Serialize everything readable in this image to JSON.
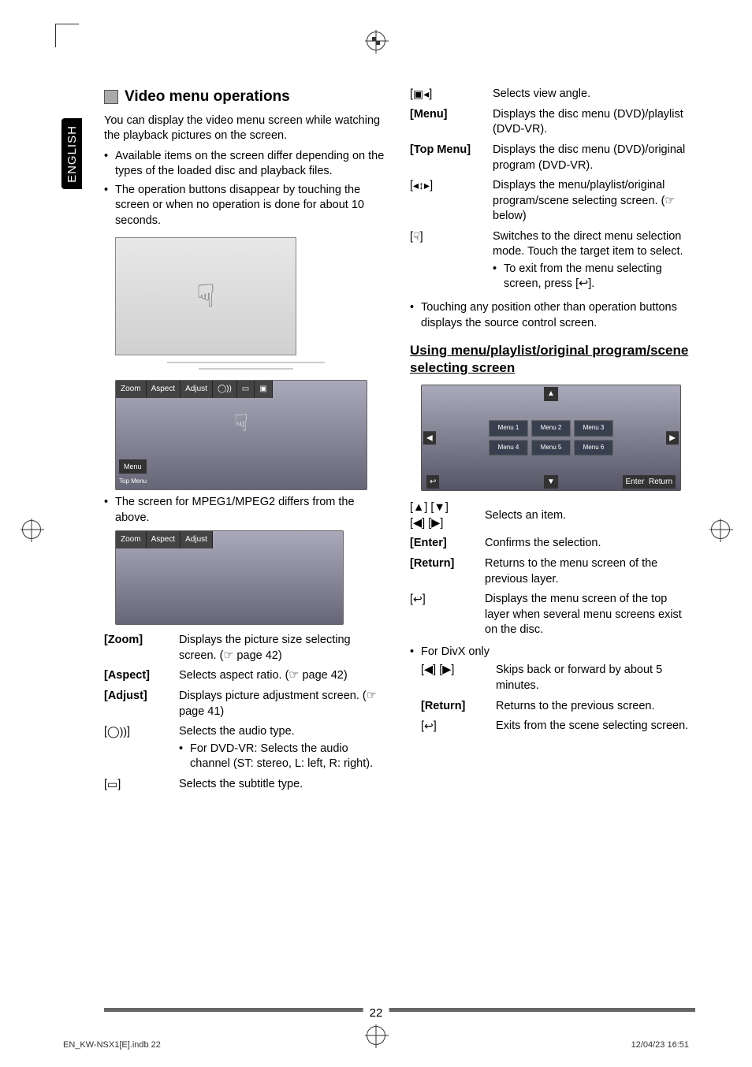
{
  "sideTab": "ENGLISH",
  "pageNumber": "22",
  "footer": {
    "left": "EN_KW-NSX1[E].indb   22",
    "right": "12/04/23   16:51"
  },
  "left": {
    "sectionTitle": "Video menu operations",
    "intro": "You can display the video menu screen while watching the playback pictures on the screen.",
    "bullets": [
      "Available items on the screen differ depending on the types of the loaded disc and playback files.",
      "The operation buttons disappear by touching the screen or when no operation is done for about 10 seconds."
    ],
    "thumbButtons": [
      "Zoom",
      "Aspect",
      "Adjust"
    ],
    "thumbMenu": "Menu",
    "thumbTopMenu": "Top Menu",
    "noteMpeg": "The screen for MPEG1/MPEG2 differs from the above.",
    "subThumbButtons": [
      "Zoom",
      "Aspect",
      "Adjust"
    ],
    "defs": [
      {
        "label": "[Zoom]",
        "bold": true,
        "desc": "Displays the picture size selecting screen. (☞ page 42)"
      },
      {
        "label": "[Aspect]",
        "bold": true,
        "desc": "Selects aspect ratio. (☞ page 42)"
      },
      {
        "label": "[Adjust]",
        "bold": true,
        "desc": "Displays picture adjustment screen. (☞ page 41)"
      },
      {
        "label": "audio-icon",
        "bold": false,
        "desc": "Selects the audio type.",
        "sub": "For DVD-VR: Selects the audio channel (ST: stereo, L: left, R: right)."
      },
      {
        "label": "subtitle-icon",
        "bold": false,
        "desc": "Selects the subtitle type."
      }
    ]
  },
  "right": {
    "defsTop": [
      {
        "label": "angle-icon",
        "bold": false,
        "desc": "Selects view angle."
      },
      {
        "label": "[Menu]",
        "bold": true,
        "desc": "Displays the disc menu (DVD)/playlist (DVD-VR)."
      },
      {
        "label": "[Top Menu]",
        "bold": true,
        "desc": "Displays the disc menu (DVD)/original program (DVD-VR)."
      },
      {
        "label": "nav-icon",
        "bold": false,
        "desc": "Displays the menu/playlist/original program/scene selecting screen. (☞ below)"
      },
      {
        "label": "direct-icon",
        "bold": false,
        "desc": "Switches to the direct menu selection mode. Touch the target item to select.",
        "sub": "To exit from the menu selecting screen, press [↩]."
      }
    ],
    "noteTouching": "Touching any position other than operation buttons displays the source control screen.",
    "subsectionTitle": "Using menu/playlist/original program/scene selecting screen",
    "menuGrid": [
      "Menu 1",
      "Menu 2",
      "Menu 3",
      "Menu 4",
      "Menu 5",
      "Menu 6"
    ],
    "menuBottom": {
      "enter": "Enter",
      "return": "Return"
    },
    "defsMid": [
      {
        "label": "arrows-icon",
        "bold": false,
        "desc": "Selects an item."
      },
      {
        "label": "[Enter]",
        "bold": true,
        "desc": "Confirms the selection."
      },
      {
        "label": "[Return]",
        "bold": true,
        "desc": "Returns to the menu screen of the previous layer."
      },
      {
        "label": "back-icon",
        "bold": false,
        "desc": "Displays the menu screen of the top layer when several menu screens exist on the disc."
      }
    ],
    "divxHeader": "For DivX only",
    "defsDivx": [
      {
        "label": "lr-icon",
        "bold": false,
        "desc": "Skips back or forward by about 5 minutes."
      },
      {
        "label": "[Return]",
        "bold": true,
        "desc": "Returns to the previous screen."
      },
      {
        "label": "back-icon",
        "bold": false,
        "desc": "Exits from the scene selecting screen."
      }
    ]
  }
}
